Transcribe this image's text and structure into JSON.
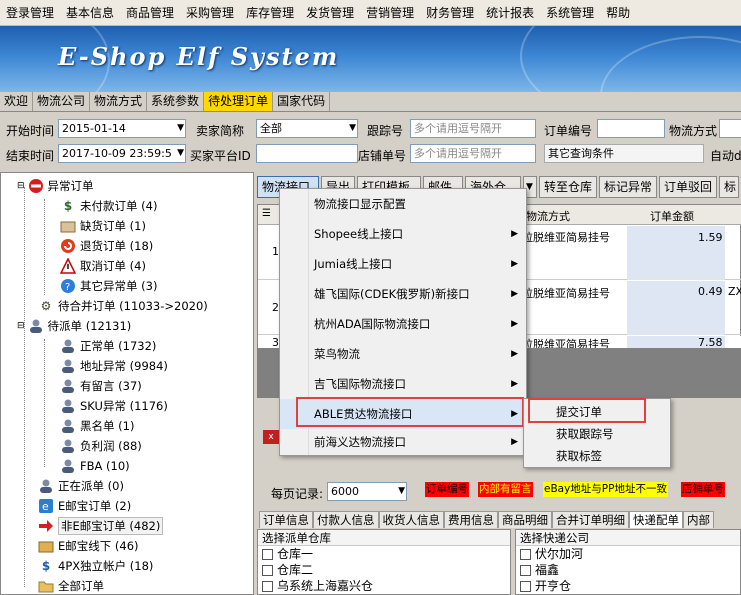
{
  "menubar": {
    "items": [
      "登录管理",
      "基本信息",
      "商品管理",
      "采购管理",
      "库存管理",
      "发货管理",
      "营销管理",
      "财务管理",
      "统计报表",
      "系统管理",
      "帮助"
    ]
  },
  "banner": {
    "title": "E-Shop Elf System"
  },
  "nav_tabs": [
    {
      "label": "欢迎",
      "active": false
    },
    {
      "label": "物流公司",
      "active": false
    },
    {
      "label": "物流方式",
      "active": false
    },
    {
      "label": "系统参数",
      "active": false
    },
    {
      "label": "待处理订单",
      "active": true
    },
    {
      "label": "国家代码",
      "active": false
    }
  ],
  "filters": {
    "start_time_label": "开始时间",
    "start_time": "2015-01-14",
    "end_time_label": "结束时间",
    "end_time": "2017-10-09 23:59:5",
    "seller_label": "卖家简称",
    "seller": "全部",
    "platform_id_label": "买家平台ID",
    "platform_id": "",
    "tracking_label": "跟踪号",
    "tracking_placeholder": "多个请用逗号隔开",
    "store_no_label": "店铺单号",
    "store_no_placeholder": "多个请用逗号隔开",
    "order_no_label": "订单编号",
    "order_no": "",
    "other_cond": "其它查询条件",
    "ship_method_label": "物流方式",
    "auto_label": "自动d"
  },
  "sidebar": {
    "items": [
      {
        "label": "异常订单",
        "icon": "no-entry-icon"
      },
      {
        "label": "未付款订单 (4)",
        "icon": "dollar-icon"
      },
      {
        "label": "缺货订单 (1)",
        "icon": "box-icon"
      },
      {
        "label": "退货订单 (18)",
        "icon": "return-icon"
      },
      {
        "label": "取消订单 (4)",
        "icon": "warning-icon"
      },
      {
        "label": "其它异常单 (3)",
        "icon": "question-icon"
      },
      {
        "label": "待合并订单 (11033->2020)",
        "icon": "gear-icon"
      },
      {
        "label": "待派单 (12131)",
        "icon": "user-icon"
      },
      {
        "label": "正常单 (1732)",
        "icon": "user-icon"
      },
      {
        "label": "地址异常 (9984)",
        "icon": "user-icon"
      },
      {
        "label": "有留言 (37)",
        "icon": "user-icon"
      },
      {
        "label": "SKU异常 (1176)",
        "icon": "user-icon"
      },
      {
        "label": "黑名单 (1)",
        "icon": "user-icon"
      },
      {
        "label": "负利润 (88)",
        "icon": "user-icon"
      },
      {
        "label": "FBA (10)",
        "icon": "user-icon"
      },
      {
        "label": "正在派单 (0)",
        "icon": "user-icon"
      },
      {
        "label": "E邮宝订单 (2)",
        "icon": "e-icon"
      },
      {
        "label": "非E邮宝订单 (482)",
        "icon": "arrow-right-icon"
      },
      {
        "label": "E邮宝线下 (46)",
        "icon": "box-icon"
      },
      {
        "label": "4PX独立帐户 (18)",
        "icon": "dollar-icon"
      },
      {
        "label": "全部订单",
        "icon": "folder-icon"
      }
    ]
  },
  "toolbar": {
    "buttons": [
      "物流接口",
      "导出",
      "打印模板",
      "邮件",
      "海外仓",
      "转至仓库",
      "标记异常",
      "订单驳回",
      "标"
    ]
  },
  "grid": {
    "headers": [
      "物流方式",
      "订单金额"
    ],
    "rows": [
      {
        "num": "1",
        "method": "拉脱维亚简易挂号",
        "amount": "1.59",
        "extra": ""
      },
      {
        "num": "2",
        "method": "拉脱维亚简易挂号",
        "amount": "0.49",
        "extra": "ZX("
      },
      {
        "num": "3",
        "method": "拉脱维亚简易挂号",
        "amount": "7.58",
        "extra": ""
      }
    ]
  },
  "context_menu": {
    "items": [
      {
        "label": "物流接口显示配置",
        "submenu": false
      },
      {
        "label": "Shopee线上接口",
        "submenu": true
      },
      {
        "label": "Jumia线上接口",
        "submenu": true
      },
      {
        "label": "雄飞国际(CDEK俄罗斯)新接口",
        "submenu": true
      },
      {
        "label": "杭州ADA国际物流接口",
        "submenu": true
      },
      {
        "label": "菜鸟物流",
        "submenu": true
      },
      {
        "label": "吉飞国际物流接口",
        "submenu": true
      },
      {
        "label": "ABLE贯达物流接口",
        "submenu": true
      },
      {
        "label": "前海义达物流接口",
        "submenu": true
      }
    ],
    "submenu": [
      "提交订单",
      "获取跟踪号",
      "获取标签"
    ]
  },
  "bottom": {
    "page_size_label": "每页记录:",
    "page_size": "6000",
    "tags": [
      {
        "label": "订单编号",
        "bg": "#ff0000",
        "fg": "#000000"
      },
      {
        "label": "内部有留言",
        "bg": "#ff0000",
        "fg": "#ffff00"
      },
      {
        "label": "eBay地址与PP地址不一致",
        "bg": "#ffff00",
        "fg": "#000000"
      },
      {
        "label": "店铺单号",
        "bg": "#ff0000",
        "fg": "#000000"
      }
    ],
    "tabs": [
      "订单信息",
      "付款人信息",
      "收货人信息",
      "费用信息",
      "商品明细",
      "合并订单明细",
      "快递配单",
      "内部"
    ],
    "active_tab": "快递配单",
    "warehouse_title": "选择派单仓库",
    "warehouses": [
      "仓库一",
      "仓库二",
      "乌系统上海嘉兴仓"
    ],
    "courier_title": "选择快递公司",
    "couriers": [
      "伏尔加河",
      "福鑫",
      "开亨仓"
    ]
  },
  "colors": {
    "accent": "#ffd800",
    "highlight_border": "#e04040",
    "banner": "#3c86d4"
  }
}
